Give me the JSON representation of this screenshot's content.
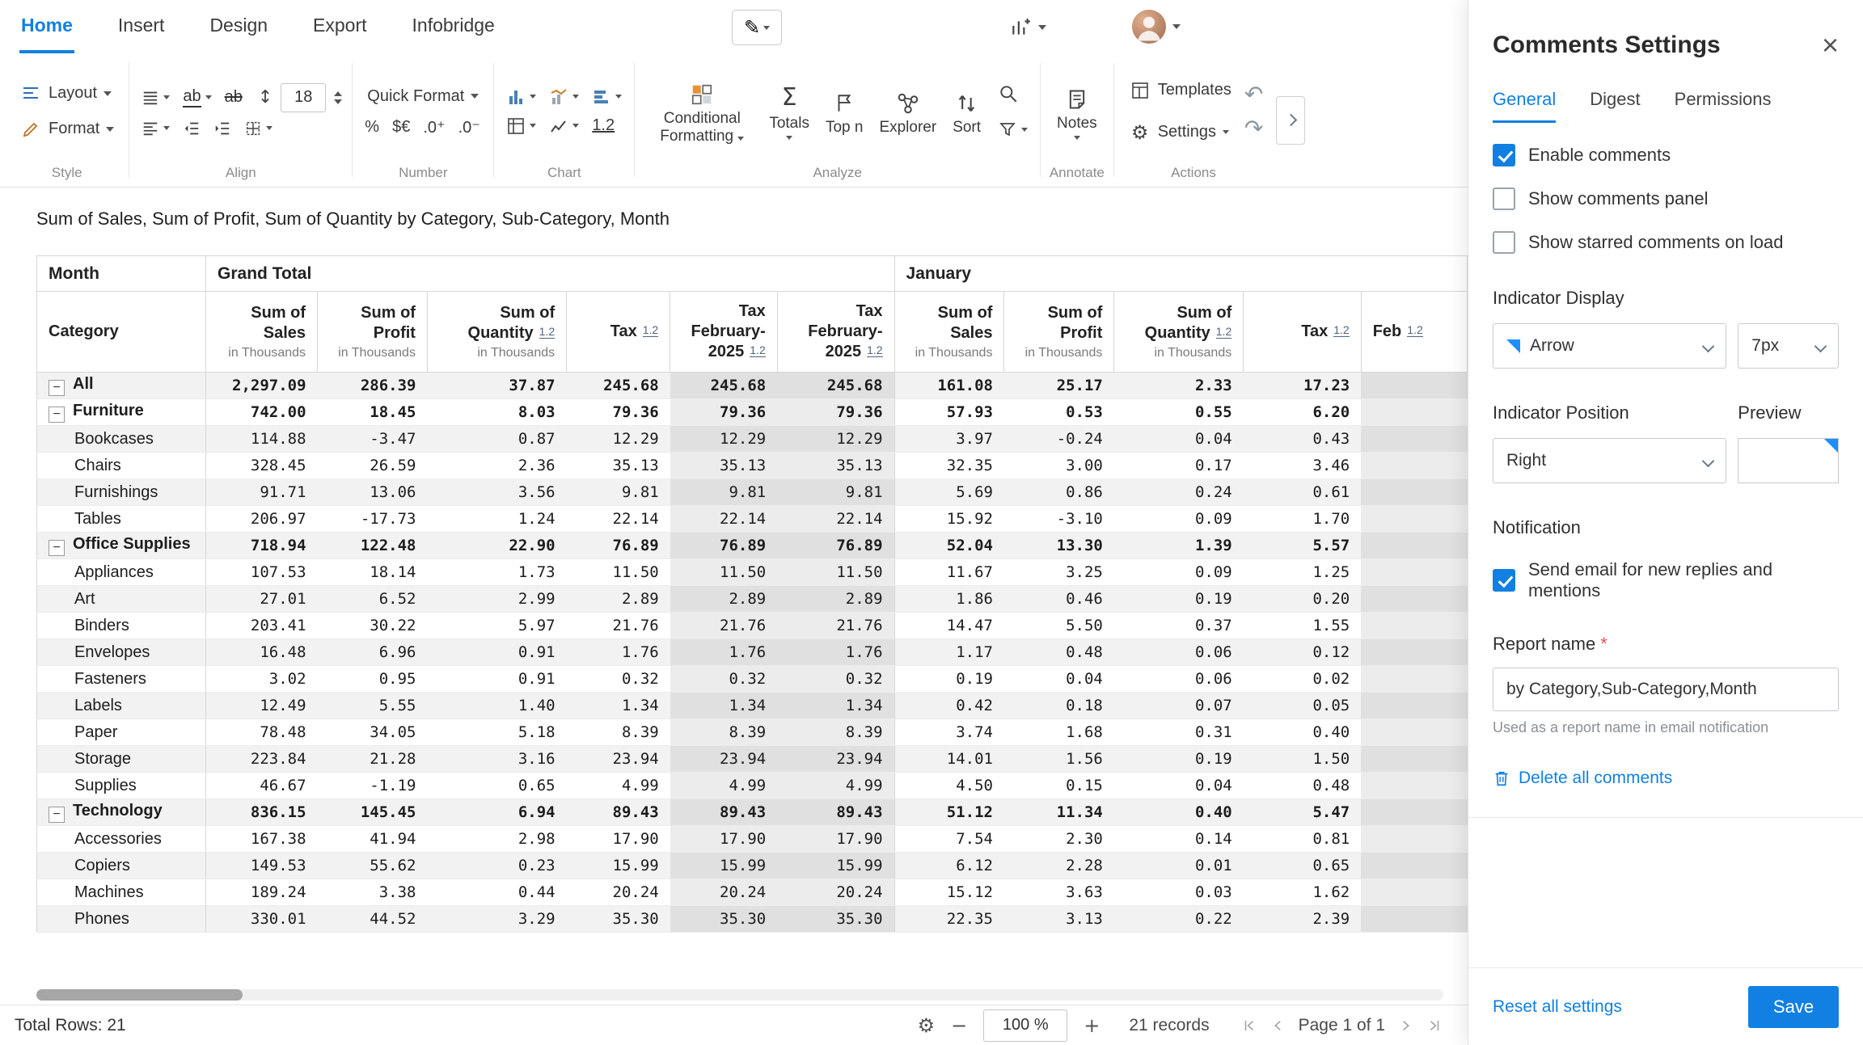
{
  "colors": {
    "accent": "#1180e2",
    "indicator": "#1e8fff"
  },
  "icons": {
    "pencil": "✎",
    "gear": "⚙",
    "sigma": "Σ",
    "undo": "↶",
    "redo": "↷",
    "updown": "↕",
    "close": "×",
    "minus": "−",
    "plus": "+",
    "collapse": "−"
  },
  "menubar": {
    "items": [
      {
        "label": "Home",
        "active": true
      },
      {
        "label": "Insert",
        "active": false
      },
      {
        "label": "Design",
        "active": false
      },
      {
        "label": "Export",
        "active": false
      },
      {
        "label": "Infobridge",
        "active": false
      }
    ]
  },
  "ribbon": {
    "style": {
      "label": "Style",
      "layout": "Layout",
      "format": "Format"
    },
    "align": {
      "label": "Align",
      "font_size": "18"
    },
    "number": {
      "label": "Number",
      "quick_format": "Quick Format",
      "percent": "%",
      "currency": "$€",
      "add_decimal": ".0⁺",
      "remove_decimal": ".0⁻"
    },
    "chart": {
      "label": "Chart",
      "decimal_badge": "1.2"
    },
    "analyze": {
      "label": "Analyze",
      "conditional": "Conditional Formatting",
      "totals": "Totals",
      "top_n": "Top n",
      "explorer": "Explorer",
      "sort": "Sort"
    },
    "annotate": {
      "label": "Annotate",
      "notes": "Notes"
    },
    "actions": {
      "label": "Actions",
      "templates": "Templates",
      "settings": "Settings"
    }
  },
  "title": "Sum of Sales, Sum of Profit, Sum of Quantity by Category, Sub-Category, Month",
  "pivot": {
    "corner_row": "Month",
    "corner_col": "Category",
    "groups": [
      {
        "label": "Grand Total",
        "span": 6
      },
      {
        "label": "January",
        "span": 5
      }
    ],
    "columns": [
      {
        "title": "Sum of Sales",
        "sub": "in Thousands"
      },
      {
        "title": "Sum of Profit",
        "sub": "in Thousands"
      },
      {
        "title": "Sum of Quantity",
        "sub": "in Thousands",
        "badge": "1.2"
      },
      {
        "title": "Tax",
        "badge": "1.2"
      },
      {
        "title": "Tax February-2025",
        "badge": "1.2",
        "highlight": true
      },
      {
        "title": "Tax February-2025",
        "badge": "1.2",
        "highlight": true
      },
      {
        "title": "Sum of Sales",
        "sub": "in Thousands"
      },
      {
        "title": "Sum of Profit",
        "sub": "in Thousands"
      },
      {
        "title": "Sum of Quantity",
        "sub": "in Thousands",
        "badge": "1.2"
      },
      {
        "title": "Tax",
        "badge": "1.2"
      },
      {
        "title": "Feb",
        "badge": "1.2",
        "highlight": true,
        "partial": true
      }
    ],
    "rows": [
      {
        "label": "All",
        "level": 0,
        "values": [
          "2,297.09",
          "286.39",
          "37.87",
          "245.68",
          "245.68",
          "245.68",
          "161.08",
          "25.17",
          "2.33",
          "17.23",
          ""
        ]
      },
      {
        "label": "Furniture",
        "level": 0,
        "values": [
          "742.00",
          "18.45",
          "8.03",
          "79.36",
          "79.36",
          "79.36",
          "57.93",
          "0.53",
          "0.55",
          "6.20",
          ""
        ]
      },
      {
        "label": "Bookcases",
        "level": 1,
        "values": [
          "114.88",
          "-3.47",
          "0.87",
          "12.29",
          "12.29",
          "12.29",
          "3.97",
          "-0.24",
          "0.04",
          "0.43",
          ""
        ]
      },
      {
        "label": "Chairs",
        "level": 1,
        "values": [
          "328.45",
          "26.59",
          "2.36",
          "35.13",
          "35.13",
          "35.13",
          "32.35",
          "3.00",
          "0.17",
          "3.46",
          ""
        ]
      },
      {
        "label": "Furnishings",
        "level": 1,
        "values": [
          "91.71",
          "13.06",
          "3.56",
          "9.81",
          "9.81",
          "9.81",
          "5.69",
          "0.86",
          "0.24",
          "0.61",
          ""
        ]
      },
      {
        "label": "Tables",
        "level": 1,
        "values": [
          "206.97",
          "-17.73",
          "1.24",
          "22.14",
          "22.14",
          "22.14",
          "15.92",
          "-3.10",
          "0.09",
          "1.70",
          ""
        ]
      },
      {
        "label": "Office Supplies",
        "level": 0,
        "values": [
          "718.94",
          "122.48",
          "22.90",
          "76.89",
          "76.89",
          "76.89",
          "52.04",
          "13.30",
          "1.39",
          "5.57",
          ""
        ]
      },
      {
        "label": "Appliances",
        "level": 1,
        "values": [
          "107.53",
          "18.14",
          "1.73",
          "11.50",
          "11.50",
          "11.50",
          "11.67",
          "3.25",
          "0.09",
          "1.25",
          ""
        ]
      },
      {
        "label": "Art",
        "level": 1,
        "values": [
          "27.01",
          "6.52",
          "2.99",
          "2.89",
          "2.89",
          "2.89",
          "1.86",
          "0.46",
          "0.19",
          "0.20",
          ""
        ]
      },
      {
        "label": "Binders",
        "level": 1,
        "values": [
          "203.41",
          "30.22",
          "5.97",
          "21.76",
          "21.76",
          "21.76",
          "14.47",
          "5.50",
          "0.37",
          "1.55",
          ""
        ]
      },
      {
        "label": "Envelopes",
        "level": 1,
        "values": [
          "16.48",
          "6.96",
          "0.91",
          "1.76",
          "1.76",
          "1.76",
          "1.17",
          "0.48",
          "0.06",
          "0.12",
          ""
        ]
      },
      {
        "label": "Fasteners",
        "level": 1,
        "values": [
          "3.02",
          "0.95",
          "0.91",
          "0.32",
          "0.32",
          "0.32",
          "0.19",
          "0.04",
          "0.06",
          "0.02",
          ""
        ]
      },
      {
        "label": "Labels",
        "level": 1,
        "values": [
          "12.49",
          "5.55",
          "1.40",
          "1.34",
          "1.34",
          "1.34",
          "0.42",
          "0.18",
          "0.07",
          "0.05",
          ""
        ]
      },
      {
        "label": "Paper",
        "level": 1,
        "values": [
          "78.48",
          "34.05",
          "5.18",
          "8.39",
          "8.39",
          "8.39",
          "3.74",
          "1.68",
          "0.31",
          "0.40",
          ""
        ]
      },
      {
        "label": "Storage",
        "level": 1,
        "values": [
          "223.84",
          "21.28",
          "3.16",
          "23.94",
          "23.94",
          "23.94",
          "14.01",
          "1.56",
          "0.19",
          "1.50",
          ""
        ]
      },
      {
        "label": "Supplies",
        "level": 1,
        "values": [
          "46.67",
          "-1.19",
          "0.65",
          "4.99",
          "4.99",
          "4.99",
          "4.50",
          "0.15",
          "0.04",
          "0.48",
          ""
        ]
      },
      {
        "label": "Technology",
        "level": 0,
        "values": [
          "836.15",
          "145.45",
          "6.94",
          "89.43",
          "89.43",
          "89.43",
          "51.12",
          "11.34",
          "0.40",
          "5.47",
          ""
        ]
      },
      {
        "label": "Accessories",
        "level": 1,
        "values": [
          "167.38",
          "41.94",
          "2.98",
          "17.90",
          "17.90",
          "17.90",
          "7.54",
          "2.30",
          "0.14",
          "0.81",
          ""
        ]
      },
      {
        "label": "Copiers",
        "level": 1,
        "values": [
          "149.53",
          "55.62",
          "0.23",
          "15.99",
          "15.99",
          "15.99",
          "6.12",
          "2.28",
          "0.01",
          "0.65",
          ""
        ]
      },
      {
        "label": "Machines",
        "level": 1,
        "values": [
          "189.24",
          "3.38",
          "0.44",
          "20.24",
          "20.24",
          "20.24",
          "15.12",
          "3.63",
          "0.03",
          "1.62",
          ""
        ]
      },
      {
        "label": "Phones",
        "level": 1,
        "values": [
          "330.01",
          "44.52",
          "3.29",
          "35.30",
          "35.30",
          "35.30",
          "22.35",
          "3.13",
          "0.22",
          "2.39",
          ""
        ]
      }
    ]
  },
  "statusbar": {
    "total_rows": "Total Rows: 21",
    "zoom": "100 %",
    "records": "21 records",
    "page": "Page 1 of 1"
  },
  "panel": {
    "title": "Comments Settings",
    "tabs": [
      {
        "label": "General",
        "active": true
      },
      {
        "label": "Digest",
        "active": false
      },
      {
        "label": "Permissions",
        "active": false
      }
    ],
    "checkboxes": [
      {
        "label": "Enable comments",
        "checked": true
      },
      {
        "label": "Show comments panel",
        "checked": false
      },
      {
        "label": "Show starred comments on load",
        "checked": false
      }
    ],
    "indicator_display": {
      "heading": "Indicator Display",
      "type": "Arrow",
      "size": "7px"
    },
    "indicator_position": {
      "heading": "Indicator Position",
      "value": "Right",
      "preview_label": "Preview"
    },
    "notification": {
      "heading": "Notification",
      "email_label": "Send email for new replies and mentions",
      "checked": true
    },
    "report_name": {
      "heading": "Report name",
      "required_mark": "*",
      "value": "by Category,Sub-Category,Month",
      "helper": "Used as a report name in email notification"
    },
    "delete_link": "Delete all comments",
    "reset_link": "Reset all settings",
    "save_label": "Save"
  }
}
